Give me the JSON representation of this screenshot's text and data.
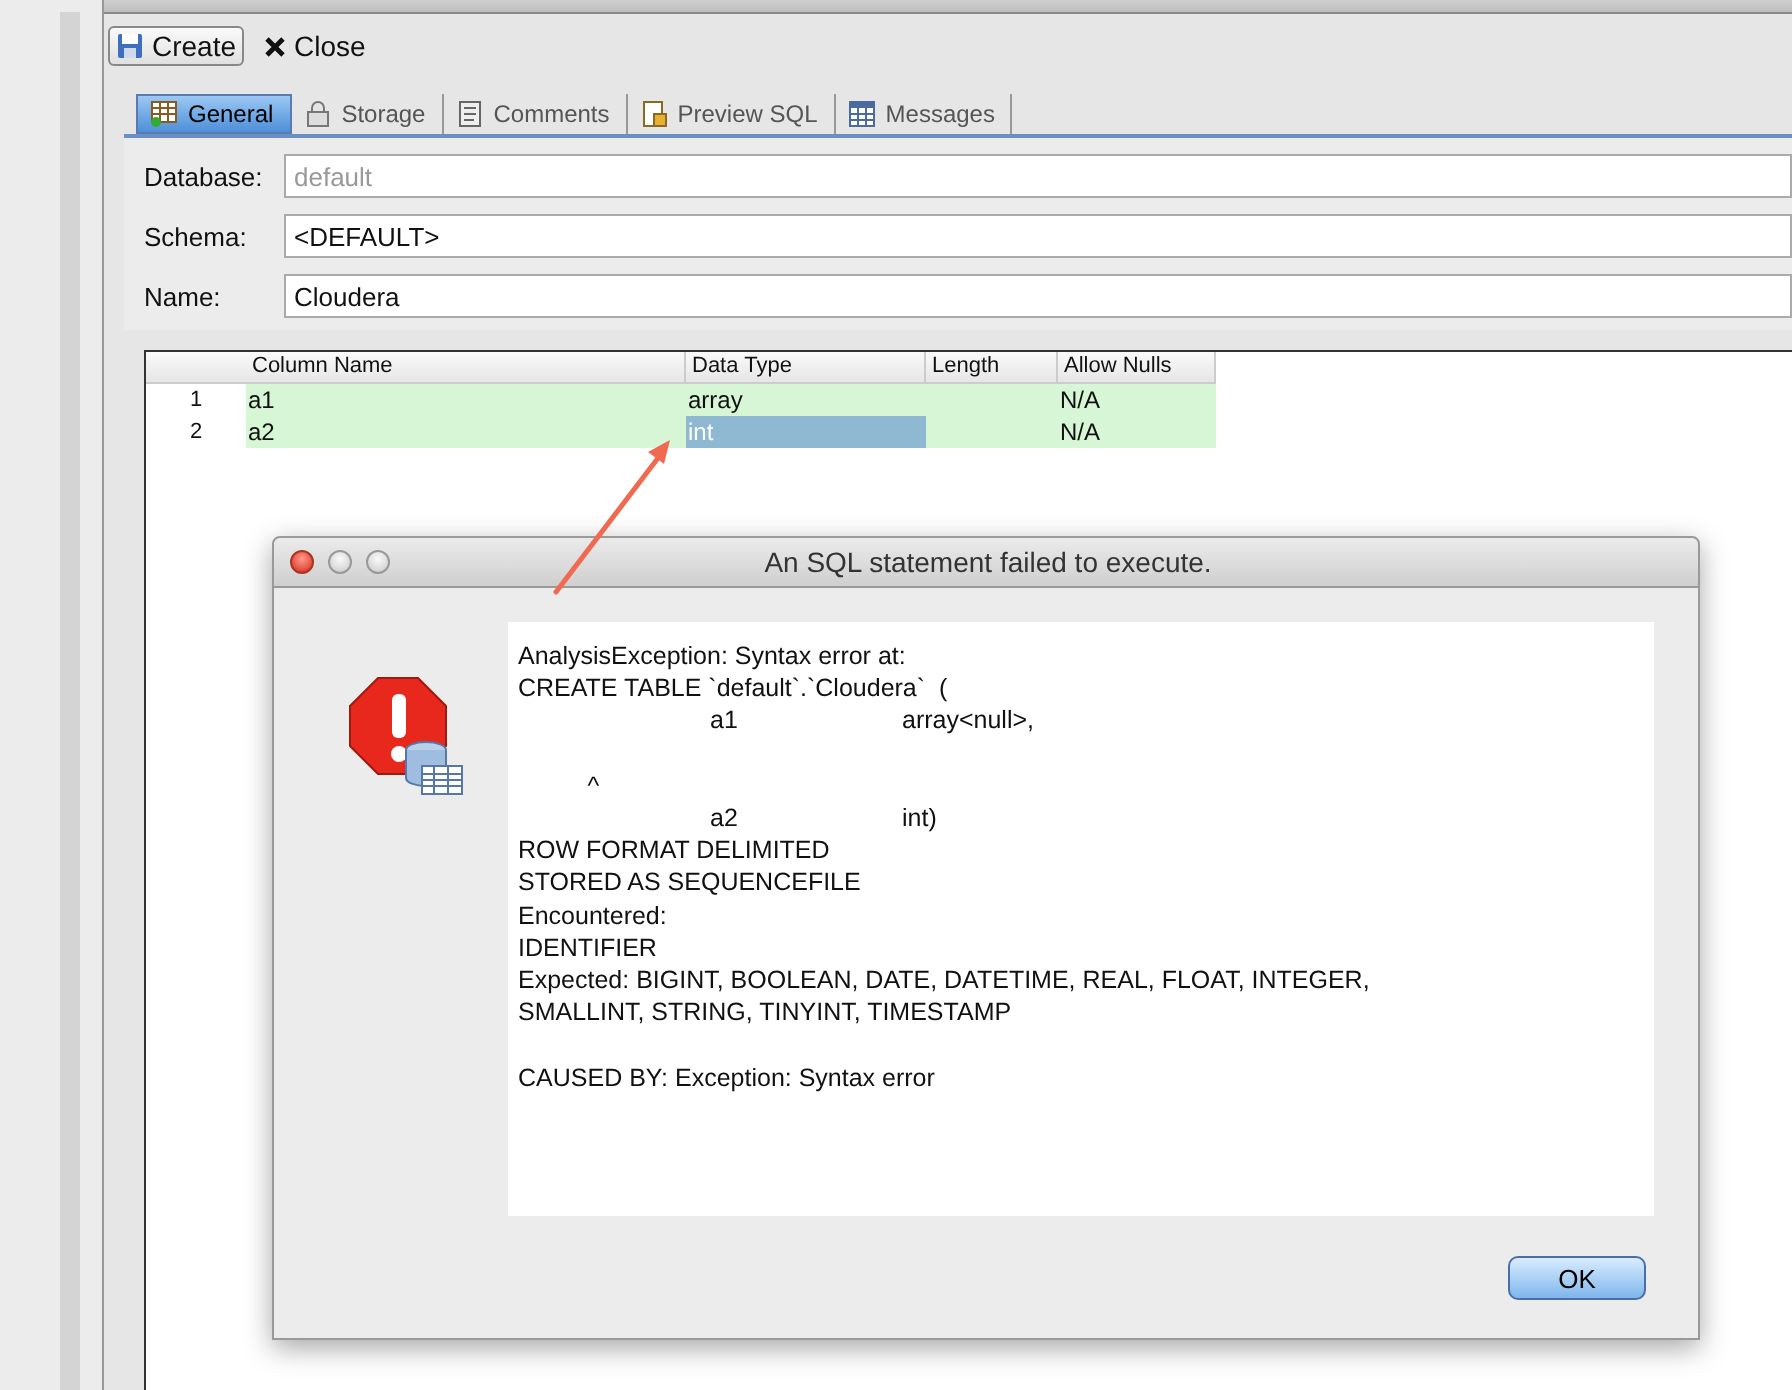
{
  "toolbar": {
    "buttons": [
      {
        "kind": "save",
        "label": "Create"
      },
      {
        "kind": "close",
        "label": "Close"
      }
    ]
  },
  "tabs": [
    {
      "kind": "grid",
      "label": "General",
      "selected": true
    },
    {
      "kind": "storage",
      "label": "Storage",
      "selected": false
    },
    {
      "kind": "note",
      "label": "Comments",
      "selected": false
    },
    {
      "kind": "script",
      "label": "Preview SQL",
      "selected": false
    },
    {
      "kind": "table",
      "label": "Messages",
      "selected": false
    }
  ],
  "form": [
    {
      "label": "Database:",
      "value": "default",
      "disabled": true
    },
    {
      "label": "Schema:",
      "value": "<DEFAULT>",
      "disabled": false
    },
    {
      "label": "Name:",
      "value": "Cloudera",
      "disabled": false
    }
  ],
  "table": {
    "columns": [
      "Column Name",
      "Data Type",
      "Length",
      "Allow Nulls"
    ],
    "rows": [
      {
        "number": "1",
        "cells": [
          {
            "text": "a1",
            "selected": false
          },
          {
            "text": "array",
            "selected": false
          },
          {
            "text": "",
            "selected": false
          },
          {
            "text": "N/A",
            "selected": false
          }
        ]
      },
      {
        "number": "2",
        "cells": [
          {
            "text": "a2",
            "selected": false
          },
          {
            "text": "int",
            "selected": true
          },
          {
            "text": "",
            "selected": false
          },
          {
            "text": "N/A",
            "selected": false
          }
        ]
      }
    ]
  },
  "dialog": {
    "title": "An SQL statement failed to execute.",
    "message": "AnalysisException: Syntax error at:\nCREATE TABLE `default`.`Cloudera`  (\n\t\ta1\t\tarray<null>,\n\n          ^\n\t\ta2\t\tint)\nROW FORMAT DELIMITED\nSTORED AS SEQUENCEFILE\nEncountered:\nIDENTIFIER\nExpected: BIGINT, BOOLEAN, DATE, DATETIME, REAL, FLOAT, INTEGER,\nSMALLINT, STRING, TINYINT, TIMESTAMP\n\nCAUSED BY: Exception: Syntax error",
    "button": "OK"
  }
}
